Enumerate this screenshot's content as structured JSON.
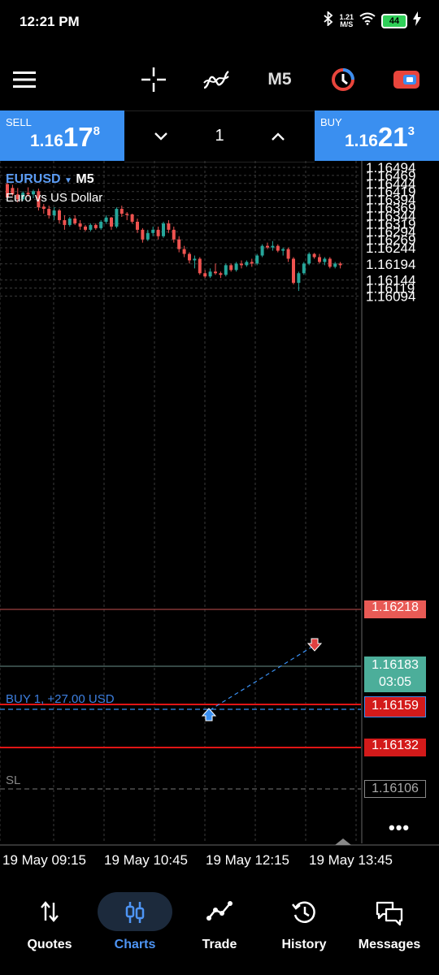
{
  "status_bar": {
    "time": "12:21 PM",
    "net_speed_value": "1.21",
    "net_speed_unit": "M/S",
    "battery": "44"
  },
  "toolbar": {
    "timeframe": "M5"
  },
  "trade_bar": {
    "sell": {
      "label": "SELL",
      "price_prefix": "1.16",
      "price_big": "17",
      "price_sup": "8"
    },
    "buy": {
      "label": "BUY",
      "price_prefix": "1.16",
      "price_big": "21",
      "price_sup": "3"
    },
    "volume": "1"
  },
  "chart": {
    "symbol": "EURUSD",
    "timeframe": "M5",
    "description": "Euro vs US Dollar",
    "order_label": "BUY 1,  +27.00 USD",
    "sl_label": "SL",
    "ask_tag": "1.16218",
    "bid_tag": "1.16183",
    "countdown": "03:05",
    "entry_tag": "1.16159",
    "red_level_tag": "1.16132",
    "sl_tag": "1.16106",
    "colors": {
      "bull": "#26a69a",
      "bear": "#ef5350",
      "accent": "#3a8ff0"
    }
  },
  "chart_data": {
    "type": "candlestick",
    "price_ticks": [
      "1.16494",
      "1.16469",
      "1.16444",
      "1.16419",
      "1.16394",
      "1.16369",
      "1.16344",
      "1.16319",
      "1.16294",
      "1.16269",
      "1.16244",
      "1.16194",
      "1.16144",
      "1.16119",
      "1.16094"
    ],
    "time_labels": [
      "19 May 09:15",
      "19 May 10:45",
      "19 May 12:15",
      "19 May 13:45"
    ],
    "ylim": [
      1.1608,
      1.165
    ],
    "candles": [
      [
        1.16442,
        1.1645,
        1.16395,
        1.164
      ],
      [
        1.1643,
        1.1644,
        1.16405,
        1.1641
      ],
      [
        1.1641,
        1.1643,
        1.16385,
        1.16395
      ],
      [
        1.16395,
        1.1642,
        1.1639,
        1.16415
      ],
      [
        1.16415,
        1.16432,
        1.16402,
        1.1641
      ],
      [
        1.1641,
        1.16425,
        1.16398,
        1.1642
      ],
      [
        1.1642,
        1.16428,
        1.1636,
        1.1637
      ],
      [
        1.16372,
        1.1638,
        1.1635,
        1.16365
      ],
      [
        1.16365,
        1.16375,
        1.16335,
        1.16345
      ],
      [
        1.16345,
        1.1637,
        1.1633,
        1.1636
      ],
      [
        1.1636,
        1.16365,
        1.1632,
        1.1633
      ],
      [
        1.1633,
        1.16345,
        1.163,
        1.16315
      ],
      [
        1.16315,
        1.1634,
        1.1631,
        1.16335
      ],
      [
        1.16335,
        1.16345,
        1.16315,
        1.1632
      ],
      [
        1.1632,
        1.1633,
        1.163,
        1.1631
      ],
      [
        1.1631,
        1.16315,
        1.16295,
        1.163
      ],
      [
        1.163,
        1.1632,
        1.16295,
        1.16315
      ],
      [
        1.16315,
        1.1632,
        1.163,
        1.16305
      ],
      [
        1.16305,
        1.1633,
        1.163,
        1.16325
      ],
      [
        1.16325,
        1.16345,
        1.16318,
        1.16338
      ],
      [
        1.16338,
        1.1634,
        1.163,
        1.1631
      ],
      [
        1.1631,
        1.1637,
        1.16305,
        1.16365
      ],
      [
        1.16365,
        1.16375,
        1.1634,
        1.1635
      ],
      [
        1.1635,
        1.16355,
        1.1633,
        1.16348
      ],
      [
        1.16348,
        1.1635,
        1.1632,
        1.16325
      ],
      [
        1.16325,
        1.16335,
        1.1629,
        1.163
      ],
      [
        1.163,
        1.16305,
        1.1626,
        1.1627
      ],
      [
        1.1627,
        1.163,
        1.16265,
        1.1629
      ],
      [
        1.1629,
        1.1631,
        1.1628,
        1.163
      ],
      [
        1.163,
        1.1631,
        1.1627,
        1.1628
      ],
      [
        1.1628,
        1.16325,
        1.16275,
        1.1632
      ],
      [
        1.1632,
        1.1633,
        1.1629,
        1.163
      ],
      [
        1.163,
        1.1631,
        1.1626,
        1.1627
      ],
      [
        1.1627,
        1.1628,
        1.1623,
        1.1624
      ],
      [
        1.1624,
        1.1625,
        1.16215,
        1.16225
      ],
      [
        1.16225,
        1.1623,
        1.16195,
        1.16205
      ],
      [
        1.16205,
        1.1622,
        1.1618,
        1.1621
      ],
      [
        1.1621,
        1.16215,
        1.1616,
        1.16165
      ],
      [
        1.16165,
        1.16175,
        1.1615,
        1.16155
      ],
      [
        1.16155,
        1.1618,
        1.1615,
        1.1617
      ],
      [
        1.1617,
        1.16195,
        1.1616,
        1.16165
      ],
      [
        1.16165,
        1.1617,
        1.1615,
        1.1616
      ],
      [
        1.1616,
        1.16195,
        1.16155,
        1.1619
      ],
      [
        1.1619,
        1.16195,
        1.1617,
        1.16175
      ],
      [
        1.16175,
        1.162,
        1.1617,
        1.16195
      ],
      [
        1.16195,
        1.16205,
        1.1618,
        1.1619
      ],
      [
        1.1619,
        1.16205,
        1.16185,
        1.162
      ],
      [
        1.162,
        1.1621,
        1.16185,
        1.16195
      ],
      [
        1.16195,
        1.16225,
        1.1619,
        1.1622
      ],
      [
        1.1622,
        1.16255,
        1.16215,
        1.1625
      ],
      [
        1.1625,
        1.1626,
        1.1624,
        1.16245
      ],
      [
        1.16245,
        1.16265,
        1.16235,
        1.1625
      ],
      [
        1.1625,
        1.16255,
        1.1623,
        1.16235
      ],
      [
        1.16235,
        1.16245,
        1.1622,
        1.1624
      ],
      [
        1.1624,
        1.16245,
        1.162,
        1.1621
      ],
      [
        1.1621,
        1.16215,
        1.1613,
        1.16135
      ],
      [
        1.16135,
        1.1617,
        1.1611,
        1.16165
      ],
      [
        1.16165,
        1.162,
        1.1616,
        1.16195
      ],
      [
        1.16195,
        1.1623,
        1.1619,
        1.16225
      ],
      [
        1.16225,
        1.16228,
        1.1621,
        1.16215
      ],
      [
        1.16215,
        1.16225,
        1.16195,
        1.162
      ],
      [
        1.162,
        1.16215,
        1.1619,
        1.1621
      ],
      [
        1.1621,
        1.16215,
        1.1618,
        1.16185
      ],
      [
        1.16185,
        1.162,
        1.1618,
        1.16195
      ],
      [
        1.16195,
        1.162,
        1.1618,
        1.1619
      ]
    ]
  },
  "nav": {
    "items": [
      {
        "label": "Quotes",
        "icon": "swap-vertical-icon"
      },
      {
        "label": "Charts",
        "icon": "candlestick-icon"
      },
      {
        "label": "Trade",
        "icon": "trade-line-icon"
      },
      {
        "label": "History",
        "icon": "history-icon"
      },
      {
        "label": "Messages",
        "icon": "messages-icon"
      }
    ],
    "active": "Charts"
  }
}
